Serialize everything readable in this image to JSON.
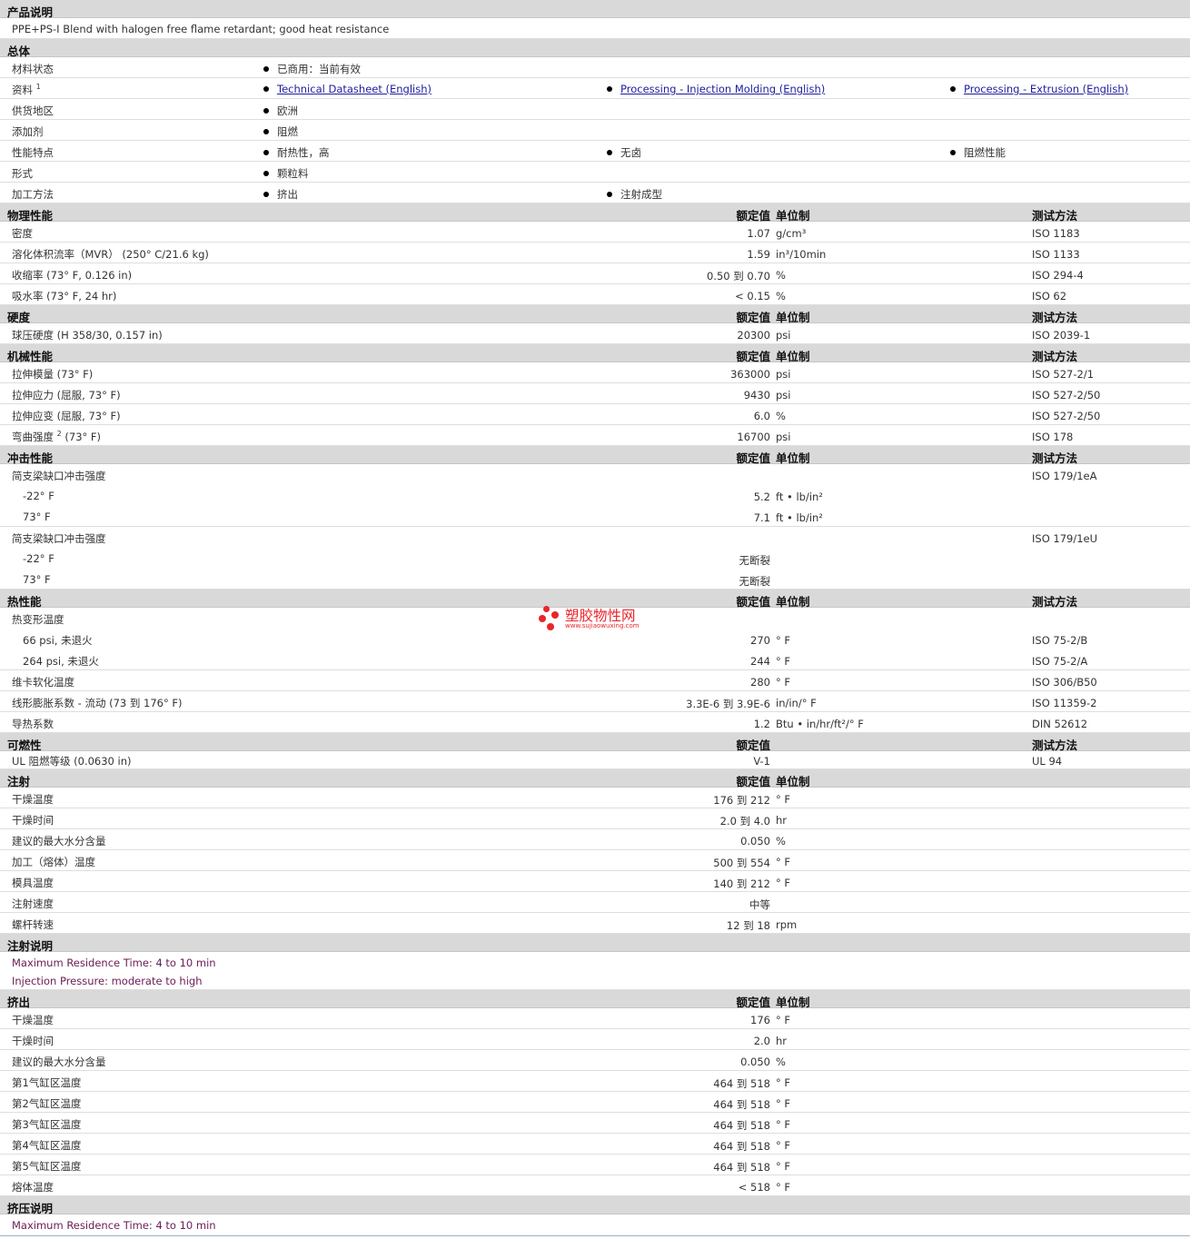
{
  "product_desc": {
    "title": "产品说明",
    "text": "PPE+PS-I Blend with halogen free flame retardant; good heat resistance"
  },
  "general": {
    "title": "总体",
    "rows": [
      {
        "label": "材料状态",
        "cells": [
          "已商用：当前有效"
        ]
      },
      {
        "label": "资料",
        "sup": "1",
        "links": [
          "Technical Datasheet (English)",
          "Processing - Injection Molding (English)",
          "Processing - Extrusion (English)"
        ]
      },
      {
        "label": "供货地区",
        "cells": [
          "欧洲"
        ]
      },
      {
        "label": "添加剂",
        "cells": [
          "阻燃"
        ]
      },
      {
        "label": "性能特点",
        "cells": [
          "耐热性，高",
          "无卤",
          "阻燃性能"
        ]
      },
      {
        "label": "形式",
        "cells": [
          "颗粒料"
        ]
      },
      {
        "label": "加工方法",
        "cells": [
          "挤出",
          "注射成型"
        ]
      }
    ]
  },
  "headers": {
    "value": "额定值",
    "unit": "单位制",
    "method": "测试方法"
  },
  "physical": {
    "title": "物理性能",
    "rows": [
      {
        "label": "密度",
        "value": "1.07",
        "unit": "g/cm³",
        "method": "ISO 1183"
      },
      {
        "label": "溶化体积流率（MVR） (250° C/21.6 kg)",
        "value": "1.59",
        "unit": "in³/10min",
        "method": "ISO 1133"
      },
      {
        "label": "收缩率 (73° F, 0.126 in)",
        "value": "0.50 到 0.70",
        "unit": "%",
        "method": "ISO 294-4"
      },
      {
        "label": "吸水率 (73° F, 24 hr)",
        "value": "< 0.15",
        "unit": "%",
        "method": "ISO 62"
      }
    ]
  },
  "hardness": {
    "title": "硬度",
    "rows": [
      {
        "label": "球压硬度 (H 358/30, 0.157 in)",
        "value": "20300",
        "unit": "psi",
        "method": "ISO 2039-1"
      }
    ]
  },
  "mechanical": {
    "title": "机械性能",
    "rows": [
      {
        "label": "拉伸模量 (73° F)",
        "value": "363000",
        "unit": "psi",
        "method": "ISO 527-2/1"
      },
      {
        "label": "拉伸应力 (屈服, 73° F)",
        "value": "9430",
        "unit": "psi",
        "method": "ISO 527-2/50"
      },
      {
        "label": "拉伸应变 (屈服, 73° F)",
        "value": "6.0",
        "unit": "%",
        "method": "ISO 527-2/50"
      },
      {
        "label": "弯曲强度",
        "sup": "2",
        "label_tail": " (73° F)",
        "value": "16700",
        "unit": "psi",
        "method": "ISO 178"
      }
    ]
  },
  "impact": {
    "title": "冲击性能",
    "rows": [
      {
        "label": "简支梁缺口冲击强度",
        "method": "ISO 179/1eA",
        "group": true
      },
      {
        "label": "-22° F",
        "value": "5.2",
        "unit": "ft • lb/in²",
        "sub": true
      },
      {
        "label": "73° F",
        "value": "7.1",
        "unit": "ft • lb/in²",
        "sub": true
      },
      {
        "label": "简支梁缺口冲击强度",
        "method": "ISO 179/1eU",
        "group": true
      },
      {
        "label": "-22° F",
        "value": "无断裂",
        "sub": true
      },
      {
        "label": "73° F",
        "value": "无断裂",
        "sub": true
      }
    ]
  },
  "thermal": {
    "title": "热性能",
    "rows": [
      {
        "label": "热变形温度",
        "group": true
      },
      {
        "label": "66 psi, 未退火",
        "value": "270",
        "unit": "° F",
        "method": "ISO 75-2/B",
        "sub": true
      },
      {
        "label": "264 psi, 未退火",
        "value": "244",
        "unit": "° F",
        "method": "ISO 75-2/A",
        "sub": true
      },
      {
        "label": "维卡软化温度",
        "value": "280",
        "unit": "° F",
        "method": "ISO 306/B50"
      },
      {
        "label": "线形膨胀系数 - 流动 (73 到 176° F)",
        "value": "3.3E-6 到 3.9E-6",
        "unit": "in/in/° F",
        "method": "ISO 11359-2"
      },
      {
        "label": "导热系数",
        "value": "1.2",
        "unit": "Btu • in/hr/ft²/° F",
        "method": "DIN 52612"
      }
    ]
  },
  "flammability": {
    "title": "可燃性",
    "rows": [
      {
        "label": "UL 阻燃等级 (0.0630 in)",
        "value": "V-1",
        "method": "UL 94"
      }
    ]
  },
  "injection": {
    "title": "注射",
    "rows": [
      {
        "label": "干燥温度",
        "value": "176 到 212",
        "unit": "° F"
      },
      {
        "label": "干燥时间",
        "value": "2.0 到 4.0",
        "unit": "hr"
      },
      {
        "label": "建议的最大水分含量",
        "value": "0.050",
        "unit": "%"
      },
      {
        "label": "加工（熔体）温度",
        "value": "500 到 554",
        "unit": "° F"
      },
      {
        "label": "模具温度",
        "value": "140 到 212",
        "unit": "° F"
      },
      {
        "label": "注射速度",
        "value": "中等"
      },
      {
        "label": "螺杆转速",
        "value": "12 到 18",
        "unit": "rpm"
      }
    ]
  },
  "injection_notes": {
    "title": "注射说明",
    "lines": [
      "Maximum Residence Time: 4 to 10 min",
      "Injection Pressure: moderate to high"
    ]
  },
  "extrusion": {
    "title": "挤出",
    "rows": [
      {
        "label": "干燥温度",
        "value": "176",
        "unit": "° F"
      },
      {
        "label": "干燥时间",
        "value": "2.0",
        "unit": "hr"
      },
      {
        "label": "建议的最大水分含量",
        "value": "0.050",
        "unit": "%"
      },
      {
        "label": "第1气缸区温度",
        "value": "464 到 518",
        "unit": "° F"
      },
      {
        "label": "第2气缸区温度",
        "value": "464 到 518",
        "unit": "° F"
      },
      {
        "label": "第3气缸区温度",
        "value": "464 到 518",
        "unit": "° F"
      },
      {
        "label": "第4气缸区温度",
        "value": "464 到 518",
        "unit": "° F"
      },
      {
        "label": "第5气缸区温度",
        "value": "464 到 518",
        "unit": "° F"
      },
      {
        "label": "熔体温度",
        "value": "< 518",
        "unit": "° F"
      }
    ]
  },
  "extrusion_notes": {
    "title": "挤压说明",
    "lines": [
      "Maximum Residence Time: 4 to 10 min"
    ]
  },
  "watermark": {
    "name": "塑胶物性网",
    "url": "www.sujiaowuxing.com",
    "color": "#e8262b"
  },
  "colors": {
    "section_bg": "#d9d9d9",
    "link": "#1d1d9e",
    "note": "#6b1b56"
  }
}
